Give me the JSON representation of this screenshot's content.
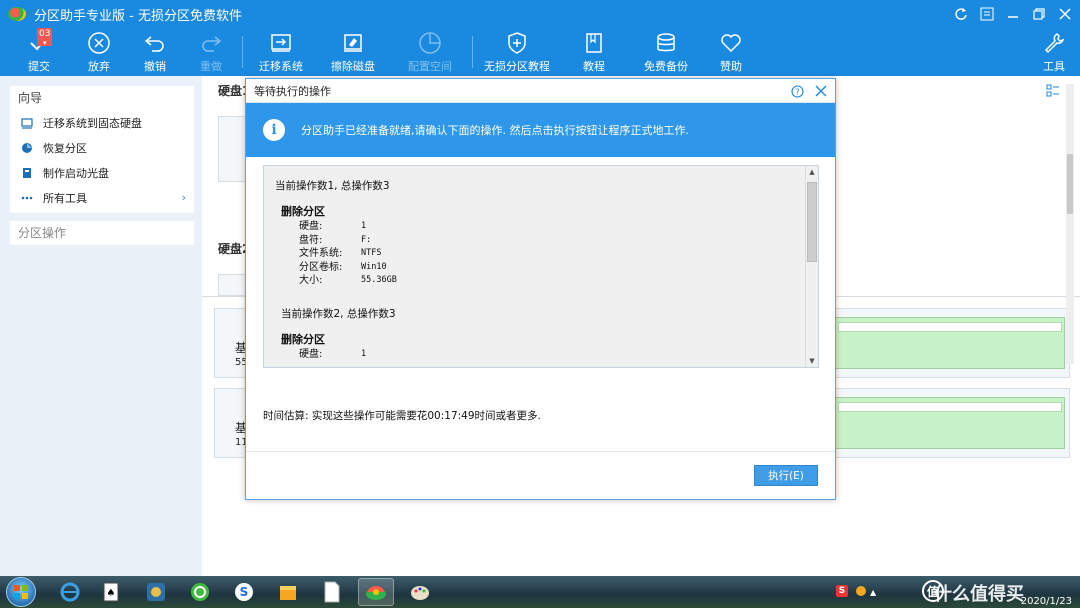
{
  "window": {
    "title": "分区助手专业版 - 无损分区免费软件"
  },
  "toolbar": {
    "submit": {
      "label": "提交",
      "badge": "03"
    },
    "discard": {
      "label": "放弃"
    },
    "undo": {
      "label": "撤销"
    },
    "redo": {
      "label": "重做"
    },
    "migrate": {
      "label": "迁移系统"
    },
    "wipe": {
      "label": "擦除磁盘"
    },
    "alloc": {
      "label": "配置空间"
    },
    "tutorial_lossless": {
      "label": "无损分区教程"
    },
    "tutorial": {
      "label": "教程"
    },
    "backup": {
      "label": "免费备份"
    },
    "sponsor": {
      "label": "赞助"
    },
    "tools": {
      "label": "工具"
    }
  },
  "sidebar": {
    "wizard_title": "向导",
    "items": [
      {
        "label": "迁移系统到固态硬盘",
        "icon": "migrate-icon"
      },
      {
        "label": "恢复分区",
        "icon": "recover-icon"
      },
      {
        "label": "制作启动光盘",
        "icon": "boot-disc-icon"
      },
      {
        "label": "所有工具",
        "icon": "more-icon"
      }
    ],
    "partition_ops_title": "分区操作"
  },
  "main": {
    "disk1_label": "硬盘1",
    "disk2_label": "硬盘2",
    "row1_type": "基",
    "row1_size": "55",
    "row2_type": "基",
    "row2_size": "11"
  },
  "dialog": {
    "title": "等待执行的操作",
    "info": "分区助手已经准备就绪,请确认下面的操作. 然后点击执行按钮让程序正式地工作.",
    "op1_header": "当前操作数1, 总操作数3",
    "op1_title": "删除分区",
    "op1_fields": [
      {
        "k": "硬盘:",
        "v": "1"
      },
      {
        "k": "盘符:",
        "v": "F:"
      },
      {
        "k": "文件系统:",
        "v": "NTFS"
      },
      {
        "k": "分区卷标:",
        "v": "Win10"
      },
      {
        "k": "大小:",
        "v": "55.36GB"
      }
    ],
    "op2_header": "当前操作数2, 总操作数3",
    "op2_title": "删除分区",
    "op2_fields": [
      {
        "k": "硬盘:",
        "v": "1"
      }
    ],
    "time_estimate": "时间估算: 实现这些操作可能需要花00:17:49时间或者更多.",
    "execute_label": "执行(E)"
  },
  "taskbar": {
    "clock_date": "2020/1/23",
    "watermark": "什么值得买",
    "wm_char": "值"
  },
  "colors": {
    "accent": "#1a89e0",
    "info_banner": "#2e97e9",
    "partition_fill": "#c8f3c8"
  }
}
